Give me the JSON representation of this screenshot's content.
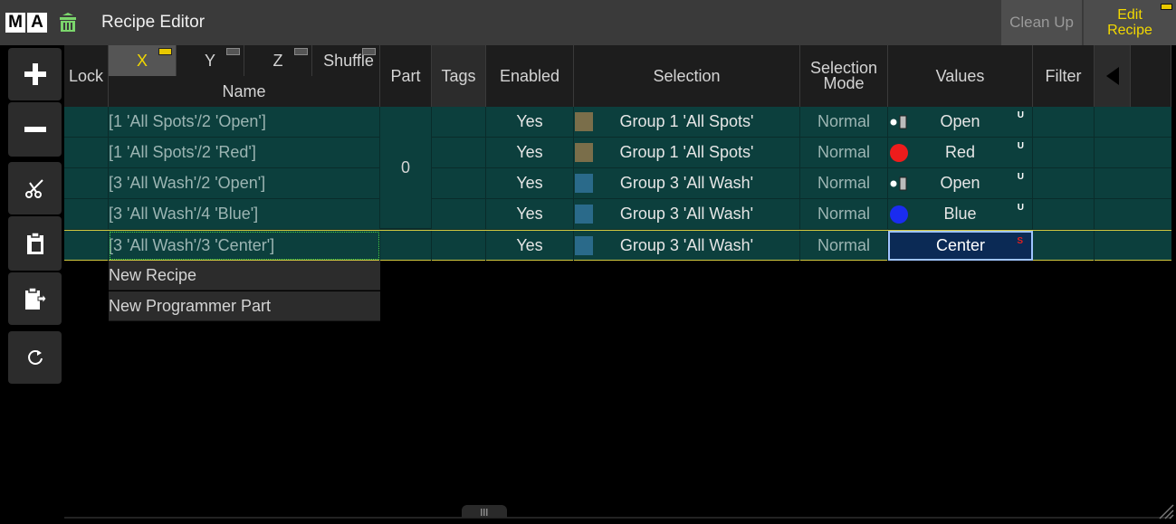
{
  "window": {
    "logo_letters": [
      "M",
      "A"
    ],
    "title": "Recipe Editor",
    "cleanup_label": "Clean Up",
    "edit_recipe_label_1": "Edit",
    "edit_recipe_label_2": "Recipe"
  },
  "toolbar": {
    "items": [
      {
        "icon": "plus-icon"
      },
      {
        "icon": "minus-icon"
      },
      {
        "icon": "scissors-icon"
      },
      {
        "icon": "paste-icon"
      },
      {
        "icon": "paste-export-icon"
      },
      {
        "icon": "refresh-icon"
      }
    ]
  },
  "columns": {
    "lock": "Lock",
    "sort_x": "X",
    "sort_y": "Y",
    "sort_z": "Z",
    "sort_shuffle": "Shuffle",
    "name": "Name",
    "part": "Part",
    "tags": "Tags",
    "enabled": "Enabled",
    "selection": "Selection",
    "selection_mode_1": "Selection",
    "selection_mode_2": "Mode",
    "values": "Values",
    "filter": "Filter"
  },
  "part_value": "0",
  "rows": [
    {
      "name": "[1 'All Spots'/2 'Open']",
      "enabled": "Yes",
      "selection": "Group 1 'All Spots'",
      "swatch": "#7a6e4a",
      "mode": "Normal",
      "value": "Open",
      "value_icon": "shutter-open-icon",
      "flag": "U"
    },
    {
      "name": "[1 'All Spots'/2 'Red']",
      "enabled": "Yes",
      "selection": "Group 1 'All Spots'",
      "swatch": "#7a6e4a",
      "mode": "Normal",
      "value": "Red",
      "value_icon": "red-dot-icon",
      "flag": "U"
    },
    {
      "name": "[3 'All Wash'/2 'Open']",
      "enabled": "Yes",
      "selection": "Group 3 'All Wash'",
      "swatch": "#2a6a8a",
      "mode": "Normal",
      "value": "Open",
      "value_icon": "shutter-open-icon",
      "flag": "U"
    },
    {
      "name": "[3 'All Wash'/4 'Blue']",
      "enabled": "Yes",
      "selection": "Group 3 'All Wash'",
      "swatch": "#2a6a8a",
      "mode": "Normal",
      "value": "Blue",
      "value_icon": "blue-dot-icon",
      "flag": "U"
    },
    {
      "name": "[3 'All Wash'/3 'Center']",
      "enabled": "Yes",
      "selection": "Group 3 'All Wash'",
      "swatch": "#2a6a8a",
      "mode": "Normal",
      "value": "Center",
      "value_icon": "",
      "flag": "S"
    }
  ],
  "new_items": {
    "new_recipe": "New Recipe",
    "new_programmer_part": "New Programmer Part"
  },
  "colors": {
    "row_bg": "#0c3f3d",
    "accent_yellow": "#f2d800",
    "selection_blue": "#0b2a55"
  }
}
